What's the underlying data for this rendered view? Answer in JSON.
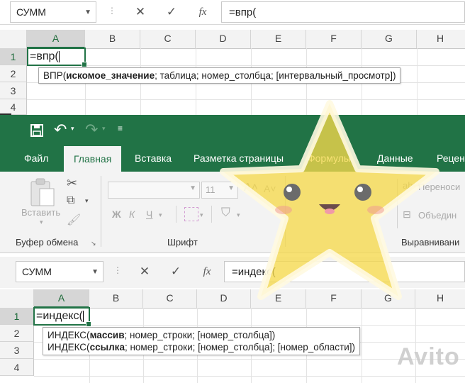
{
  "top": {
    "name_box": "СУММ",
    "formula": "=впр(",
    "columns": [
      "A",
      "B",
      "C",
      "D",
      "E",
      "F",
      "G",
      "H"
    ],
    "rows": [
      "1",
      "2",
      "3",
      "4"
    ],
    "cell_value": "=впр(",
    "tooltip": {
      "fn": "ВПР(",
      "bold_arg": "искомое_значение",
      "rest": "; таблица; номер_столбца; [интервальный_просмотр])"
    }
  },
  "ribbon": {
    "tabs": [
      "Файл",
      "Главная",
      "Вставка",
      "Разметка страницы",
      "Формулы",
      "Данные",
      "Рецен"
    ],
    "active_tab": "Главная",
    "paste_label": "Вставить",
    "font_size": "11",
    "bold": "Ж",
    "italic": "К",
    "underline": "Ч",
    "wrap_text": "Переноси",
    "merge": "Объедин",
    "groups": {
      "clipboard": "Буфер обмена",
      "font": "Шрифт",
      "alignment": "Выравнивани"
    }
  },
  "bottom": {
    "name_box": "СУММ",
    "formula": "=индекс(",
    "columns": [
      "A",
      "B",
      "C",
      "D",
      "E",
      "F",
      "G",
      "H"
    ],
    "rows": [
      "1",
      "2",
      "3",
      "4"
    ],
    "cell_value": "=индекс(",
    "tooltip_lines": [
      {
        "fn": "ИНДЕКС(",
        "bold_arg": "массив",
        "rest": "; номер_строки; [номер_столбца])"
      },
      {
        "fn": "ИНДЕКС(",
        "bold_arg": "ссылка",
        "rest": "; номер_строки; [номер_столбца]; [номер_области])"
      }
    ]
  },
  "icons": {
    "cancel": "✕",
    "enter": "✓",
    "fx": "fx"
  },
  "watermark": "Avito",
  "colors": {
    "excel_green": "#217346",
    "star_yellow": "#f5d84c"
  }
}
